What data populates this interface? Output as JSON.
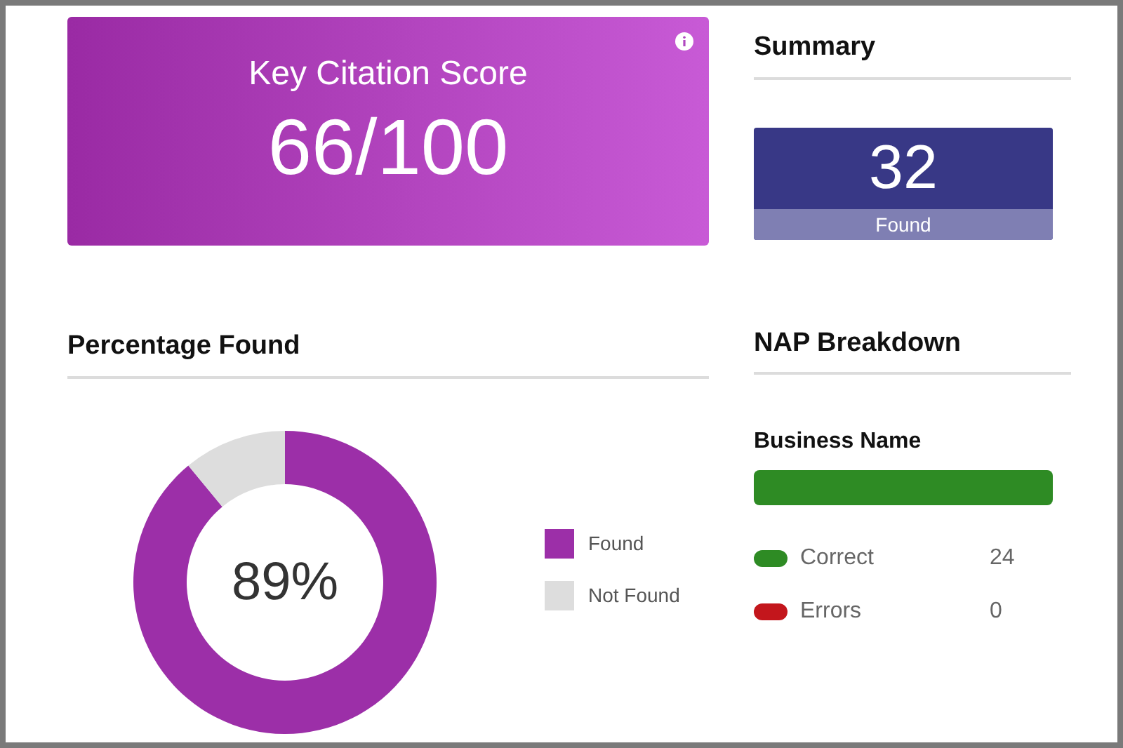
{
  "score_card": {
    "title": "Key Citation Score",
    "value": "66/100"
  },
  "summary": {
    "heading": "Summary",
    "count": "32",
    "caption": "Found"
  },
  "percentage": {
    "heading": "Percentage Found",
    "center_label": "89%",
    "legend": [
      {
        "label": "Found",
        "color": "#9c2fa8"
      },
      {
        "label": "Not Found",
        "color": "#dddddd"
      }
    ]
  },
  "nap": {
    "heading": "NAP Breakdown",
    "sections": [
      {
        "title": "Business Name",
        "rows": [
          {
            "label": "Correct",
            "count": "24",
            "color": "#2e8b24"
          },
          {
            "label": "Errors",
            "count": "0",
            "color": "#c3161c"
          }
        ]
      }
    ]
  }
}
